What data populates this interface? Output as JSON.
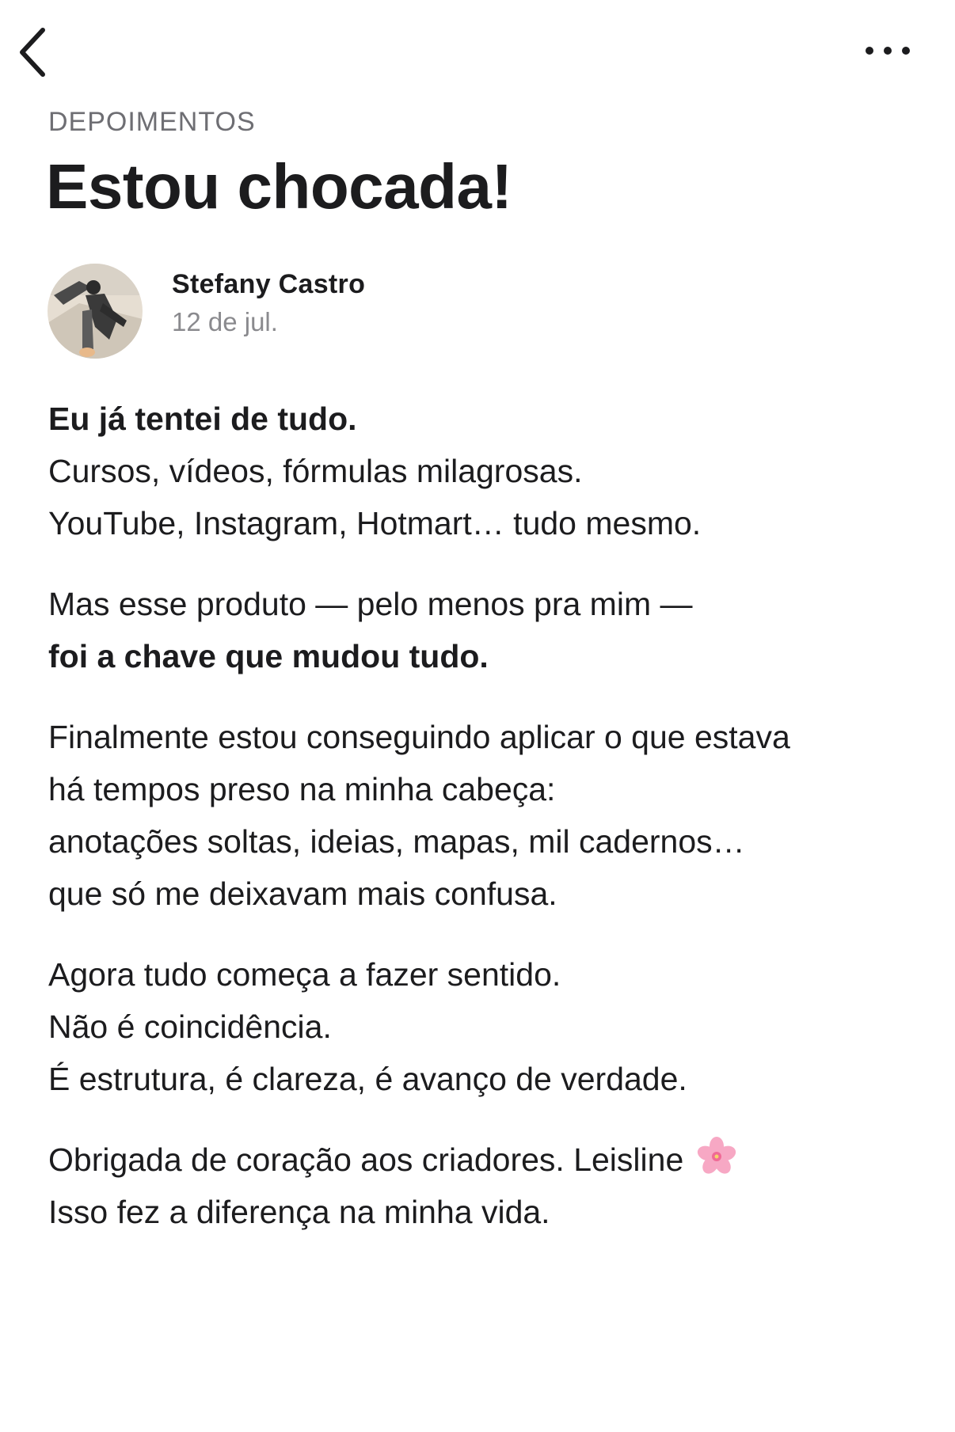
{
  "nav": {
    "back_icon": "chevron-left-icon",
    "more_icon": "ellipsis-horizontal-icon"
  },
  "post": {
    "category": "DEPOIMENTOS",
    "title": "Estou chocada!",
    "author": {
      "name": "Stefany Castro",
      "date": "12 de jul."
    },
    "paragraphs": [
      {
        "lines": [
          "Eu já tentei de tudo.",
          "Cursos, vídeos, fórmulas milagrosas.",
          "YouTube, Instagram, Hotmart… tudo mesmo."
        ]
      },
      {
        "lines": [
          "Mas esse produto — pelo menos pra mim —",
          "foi a chave que mudou tudo."
        ]
      },
      {
        "lines": [
          "Finalmente estou conseguindo aplicar o que estava",
          "há tempos preso na minha cabeça:",
          "anotações soltas, ideias, mapas, mil cadernos…",
          "que só me deixavam mais confusa."
        ]
      },
      {
        "lines": [
          "Agora tudo começa a fazer sentido.",
          "Não é coincidência.",
          "É estrutura, é clareza, é avanço de verdade."
        ]
      },
      {
        "lines": [
          "Obrigada de coração aos criadores. Leisline",
          "Isso fez a diferença na minha vida."
        ]
      }
    ],
    "emoji_icon": "cherry-blossom-icon"
  },
  "colors": {
    "text": "#1c1c1e",
    "secondary": "#6e6e73",
    "muted": "#8a8a8e",
    "background": "#ffffff",
    "blossom": "#f7a8c4"
  }
}
